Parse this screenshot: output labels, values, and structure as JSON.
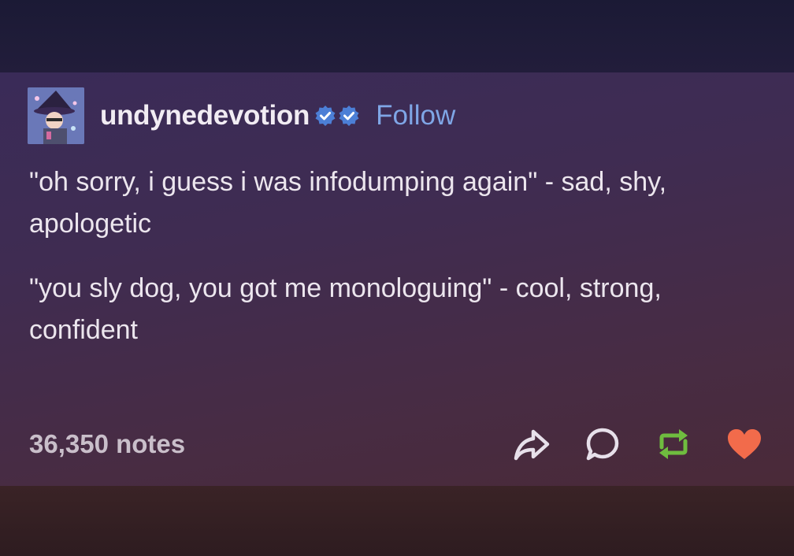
{
  "post": {
    "username": "undynedevotion",
    "follow_label": "Follow",
    "paragraphs": [
      "\"oh sorry, i guess i was infodumping again\" - sad, shy, apologetic",
      "\"you sly dog, you got me monologuing\" - cool, strong, confident"
    ],
    "notes": "36,350 notes"
  },
  "icons": {
    "verified_badges": [
      "verified-badge-icon",
      "verified-badge-icon"
    ],
    "share": "share-arrow-icon",
    "reply": "reply-bubble-icon",
    "reblog": "reblog-icon",
    "like": "heart-icon"
  },
  "colors": {
    "follow_link": "#7fa6e6",
    "verified_badge": "#4c7fd6",
    "reblog": "#6fbd3f",
    "like": "#f26b4b",
    "text": "#ece6ee"
  }
}
